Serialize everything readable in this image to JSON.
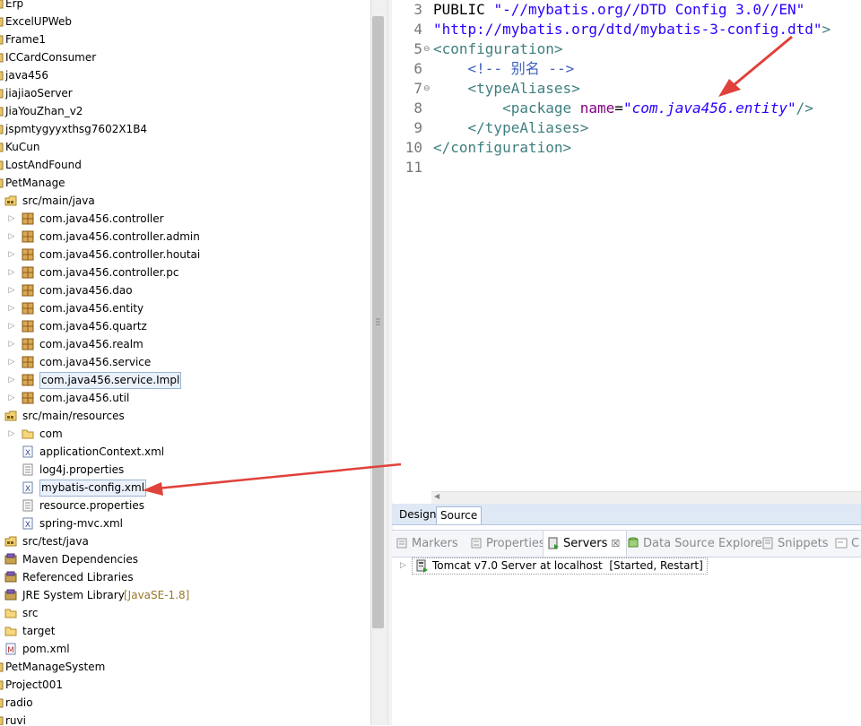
{
  "explorer": {
    "rows": [
      {
        "label": "Erp",
        "level": 0,
        "icon": "project",
        "arrow": false
      },
      {
        "label": "ExcelUPWeb",
        "level": 0,
        "icon": "project",
        "arrow": false
      },
      {
        "label": "Frame1",
        "level": 0,
        "icon": "project",
        "arrow": false
      },
      {
        "label": "ICCardConsumer",
        "level": 0,
        "icon": "project",
        "arrow": false
      },
      {
        "label": "java456",
        "level": 0,
        "icon": "project",
        "arrow": false
      },
      {
        "label": "jiajiaoServer",
        "level": 0,
        "icon": "project",
        "arrow": false
      },
      {
        "label": "JiaYouZhan_v2",
        "level": 0,
        "icon": "project",
        "arrow": false
      },
      {
        "label": "jspmtygyyxthsg7602X1B4",
        "level": 0,
        "icon": "project",
        "arrow": false
      },
      {
        "label": "KuCun",
        "level": 0,
        "icon": "project",
        "arrow": false
      },
      {
        "label": "LostAndFound",
        "level": 0,
        "icon": "project",
        "arrow": false
      },
      {
        "label": "PetManage",
        "level": 0,
        "icon": "project",
        "arrow": false
      },
      {
        "label": "src/main/java",
        "level": 1,
        "icon": "source-folder",
        "arrow": false
      },
      {
        "label": "com.java456.controller",
        "level": 2,
        "icon": "package",
        "arrow": true
      },
      {
        "label": "com.java456.controller.admin",
        "level": 2,
        "icon": "package",
        "arrow": true
      },
      {
        "label": "com.java456.controller.houtai",
        "level": 2,
        "icon": "package",
        "arrow": true
      },
      {
        "label": "com.java456.controller.pc",
        "level": 2,
        "icon": "package",
        "arrow": true
      },
      {
        "label": "com.java456.dao",
        "level": 2,
        "icon": "package",
        "arrow": true
      },
      {
        "label": "com.java456.entity",
        "level": 2,
        "icon": "package",
        "arrow": true
      },
      {
        "label": "com.java456.quartz",
        "level": 2,
        "icon": "package",
        "arrow": true
      },
      {
        "label": "com.java456.realm",
        "level": 2,
        "icon": "package",
        "arrow": true
      },
      {
        "label": "com.java456.service",
        "level": 2,
        "icon": "package",
        "arrow": true
      },
      {
        "label": "com.java456.service.Impl",
        "level": 2,
        "icon": "package",
        "arrow": true,
        "boxed": true
      },
      {
        "label": "com.java456.util",
        "level": 2,
        "icon": "package",
        "arrow": true
      },
      {
        "label": "src/main/resources",
        "level": 1,
        "icon": "source-folder",
        "arrow": false
      },
      {
        "label": "com",
        "level": 2,
        "icon": "folder",
        "arrow": true
      },
      {
        "label": "applicationContext.xml",
        "level": 2,
        "icon": "xml-file",
        "arrow": false
      },
      {
        "label": "log4j.properties",
        "level": 2,
        "icon": "properties-file",
        "arrow": false
      },
      {
        "label": "mybatis-config.xml",
        "level": 2,
        "icon": "xml-file",
        "arrow": false,
        "boxed": true
      },
      {
        "label": "resource.properties",
        "level": 2,
        "icon": "properties-file",
        "arrow": false
      },
      {
        "label": "spring-mvc.xml",
        "level": 2,
        "icon": "xml-file",
        "arrow": false
      },
      {
        "label": "src/test/java",
        "level": 1,
        "icon": "source-folder",
        "arrow": false
      },
      {
        "label": "Maven Dependencies",
        "level": 1,
        "icon": "library",
        "arrow": false
      },
      {
        "label": "Referenced Libraries",
        "level": 1,
        "icon": "library",
        "arrow": false
      },
      {
        "label": "JRE System Library",
        "level": 1,
        "icon": "library",
        "arrow": false,
        "deco": "[JavaSE-1.8]"
      },
      {
        "label": "src",
        "level": 1,
        "icon": "folder",
        "arrow": false
      },
      {
        "label": "target",
        "level": 1,
        "icon": "folder",
        "arrow": false
      },
      {
        "label": "pom.xml",
        "level": 1,
        "icon": "maven-file",
        "arrow": false
      },
      {
        "label": "PetManageSystem",
        "level": 0,
        "icon": "project",
        "arrow": false
      },
      {
        "label": "Project001",
        "level": 0,
        "icon": "project",
        "arrow": false
      },
      {
        "label": "radio",
        "level": 0,
        "icon": "project",
        "arrow": false
      },
      {
        "label": "ruvi",
        "level": 0,
        "icon": "project",
        "arrow": false
      }
    ]
  },
  "editor": {
    "lines": [
      {
        "num": "3",
        "fold": "",
        "tokens": [
          {
            "t": "plain",
            "v": "PUBLIC "
          },
          {
            "t": "str",
            "v": "\"-//mybatis.org//DTD Config 3.0//EN\""
          }
        ]
      },
      {
        "num": "4",
        "fold": "",
        "tokens": [
          {
            "t": "str",
            "v": "\"http://mybatis.org/dtd/mybatis-3-config.dtd\""
          },
          {
            "t": "tag",
            "v": ">"
          }
        ]
      },
      {
        "num": "5",
        "fold": "⊖",
        "tokens": [
          {
            "t": "tag",
            "v": "<configuration>"
          }
        ]
      },
      {
        "num": "6",
        "fold": "",
        "tokens": [
          {
            "t": "plain",
            "v": "    "
          },
          {
            "t": "com",
            "v": "<!-- 别名 -->"
          }
        ]
      },
      {
        "num": "7",
        "fold": "⊖",
        "tokens": [
          {
            "t": "plain",
            "v": "    "
          },
          {
            "t": "tag",
            "v": "<typeAliases>"
          }
        ]
      },
      {
        "num": "8",
        "fold": "",
        "tokens": [
          {
            "t": "plain",
            "v": "        "
          },
          {
            "t": "tag",
            "v": "<package "
          },
          {
            "t": "attr",
            "v": "name"
          },
          {
            "t": "plain",
            "v": "="
          },
          {
            "t": "val",
            "v": "\"com.java456.entity\""
          },
          {
            "t": "tag",
            "v": "/>"
          }
        ]
      },
      {
        "num": "9",
        "fold": "",
        "tokens": [
          {
            "t": "plain",
            "v": "    "
          },
          {
            "t": "tag",
            "v": "</typeAliases>"
          }
        ]
      },
      {
        "num": "10",
        "fold": "",
        "tokens": [
          {
            "t": "tag",
            "v": "</configuration>"
          }
        ]
      },
      {
        "num": "11",
        "fold": "",
        "tokens": []
      }
    ]
  },
  "design_tabs": {
    "design": "Design",
    "source": "Source"
  },
  "views": {
    "tabs": [
      {
        "label": "Markers",
        "icon": "markers-icon",
        "active": false
      },
      {
        "label": "Properties",
        "icon": "properties-icon",
        "active": false
      },
      {
        "label": "Servers",
        "icon": "servers-icon",
        "active": true,
        "close": "☒"
      },
      {
        "label": "Data Source Explorer",
        "icon": "data-source-icon",
        "active": false
      },
      {
        "label": "Snippets",
        "icon": "snippets-icon",
        "active": false
      },
      {
        "label": "C",
        "icon": "console-icon",
        "active": false
      }
    ],
    "server": {
      "name": "Tomcat v7.0 Server at localhost",
      "status": "[Started, Restart]"
    }
  },
  "colors": {
    "annotation": "#e0413a",
    "tag": "#3f7f7f",
    "attr": "#7f007f",
    "value": "#2a00ff",
    "comment": "#3f5fbf"
  }
}
